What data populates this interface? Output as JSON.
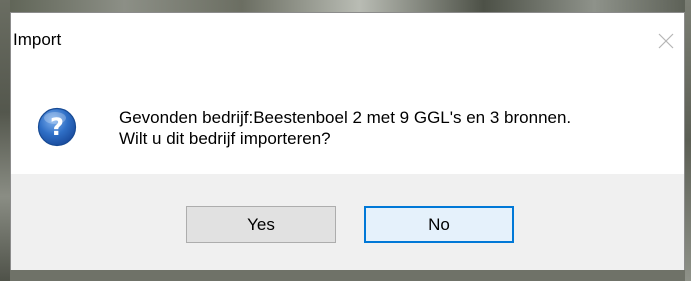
{
  "window": {
    "title": "Import",
    "close_glyph": "×"
  },
  "message": {
    "line1": "Gevonden bedrijf:Beestenboel 2 met 9 GGL's en 3 bronnen.",
    "line2": "Wilt u dit bedrijf importeren?",
    "icon": "question-icon"
  },
  "buttons": {
    "yes_label": "Yes",
    "no_label": "No"
  },
  "colors": {
    "icon_blue": "#1f5fb8",
    "focus_border": "#0078d7"
  }
}
